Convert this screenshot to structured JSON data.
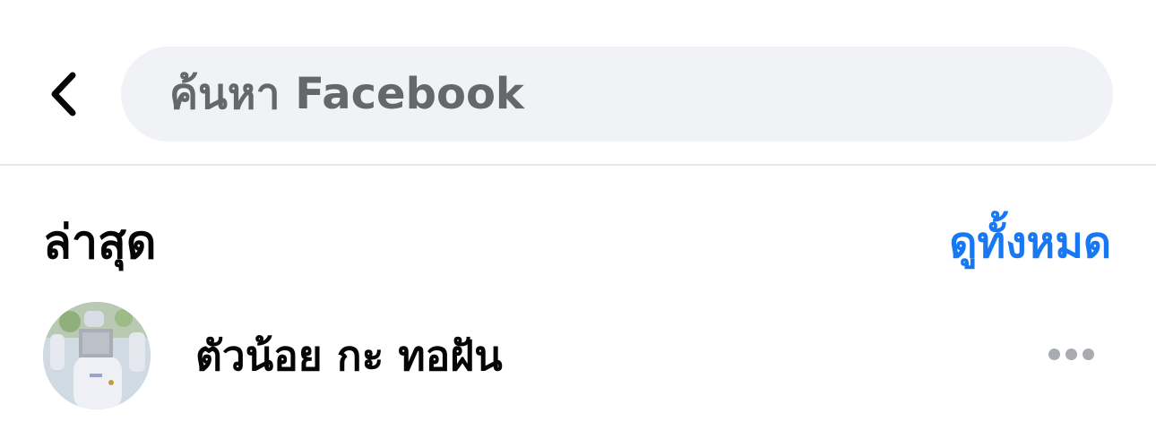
{
  "search": {
    "placeholder": "ค้นหา Facebook"
  },
  "recent": {
    "title": "ล่าสุด",
    "see_all_label": "ดูทั้งหมด",
    "items": [
      {
        "name": "ตัวน้อย กะ ทอฝัน"
      }
    ]
  },
  "colors": {
    "accent": "#1877f2",
    "search_bg": "#f0f2f5",
    "muted_text": "#65676b",
    "primary_text": "#050505"
  },
  "icons": {
    "back": "chevron-left-icon",
    "more": "more-horizontal-icon"
  }
}
